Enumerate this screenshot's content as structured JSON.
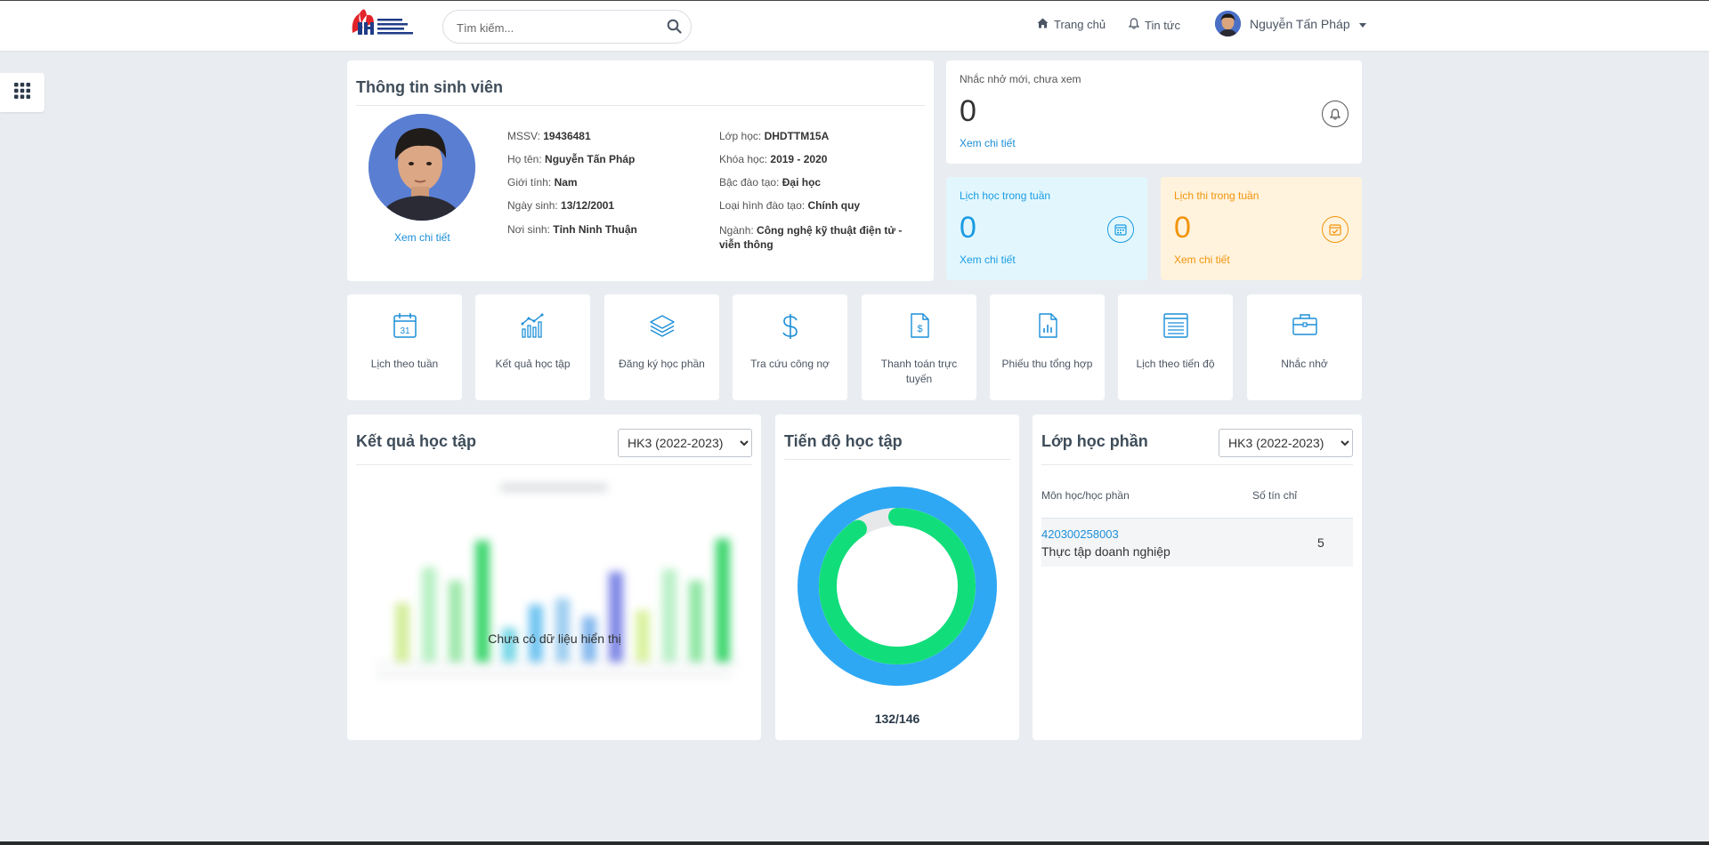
{
  "header": {
    "search_placeholder": "Tìm kiếm...",
    "nav_home": "Trang chủ",
    "nav_news": "Tin tức",
    "user_name": "Nguyễn Tấn Pháp"
  },
  "student": {
    "title": "Thông tin sinh viên",
    "view_detail": "Xem chi tiết",
    "fields": [
      {
        "label": "MSSV:",
        "value": "19436481"
      },
      {
        "label": "Họ tên:",
        "value": "Nguyễn Tấn Pháp"
      },
      {
        "label": "Giới tính:",
        "value": "Nam"
      },
      {
        "label": "Ngày sinh:",
        "value": "13/12/2001"
      },
      {
        "label": "Nơi sinh:",
        "value": "Tỉnh Ninh Thuận"
      },
      {
        "label": "Lớp học:",
        "value": "DHDTTM15A"
      },
      {
        "label": "Khóa học:",
        "value": "2019 - 2020"
      },
      {
        "label": "Bậc đào tạo:",
        "value": "Đại học"
      },
      {
        "label": "Loại hình đào tạo:",
        "value": "Chính quy"
      },
      {
        "label": "Ngành:",
        "value": "Công nghệ kỹ thuật điện tử - viễn thông"
      }
    ]
  },
  "stats": {
    "reminders": {
      "label": "Nhắc nhở mới, chưa xem",
      "count": "0",
      "link": "Xem chi tiết"
    },
    "week_schedule": {
      "label": "Lịch học trong tuần",
      "count": "0",
      "link": "Xem chi tiết"
    },
    "exam_schedule": {
      "label": "Lịch thi trong tuần",
      "count": "0",
      "link": "Xem chi tiết"
    }
  },
  "quick_links": [
    {
      "label": "Lịch theo tuần",
      "icon": "calendar-31-icon"
    },
    {
      "label": "Kết quả học tập",
      "icon": "bar-chart-trend-icon"
    },
    {
      "label": "Đăng ký học phần",
      "icon": "layers-icon"
    },
    {
      "label": "Tra cứu công nợ",
      "icon": "dollar-icon"
    },
    {
      "label": "Thanh toán trực tuyến",
      "icon": "invoice-dollar-icon"
    },
    {
      "label": "Phiếu thu tổng hợp",
      "icon": "document-chart-icon"
    },
    {
      "label": "Lịch theo tiến độ",
      "icon": "list-document-icon"
    },
    {
      "label": "Nhắc nhở",
      "icon": "briefcase-icon"
    }
  ],
  "results": {
    "title": "Kết quả học tập",
    "semester": "HK3 (2022-2023)",
    "no_data": "Chưa có dữ liệu hiển thị"
  },
  "progress": {
    "title": "Tiến độ học tập",
    "completed": 132,
    "total": 146,
    "text": "132/146"
  },
  "classes": {
    "title": "Lớp học phần",
    "semester": "HK3 (2022-2023)",
    "col_course": "Môn học/học phần",
    "col_credits": "Số tín chỉ",
    "rows": [
      {
        "code": "420300258003",
        "name": "Thực tập doanh nghiệp",
        "credits": "5"
      }
    ]
  },
  "colors": {
    "accent_blue": "#1b8ed8",
    "week_bg": "#e2f7fd",
    "exam_bg": "#fff3dd",
    "exam_orange": "#f1940b",
    "donut_outer": "#2fa8f4",
    "donut_inner": "#11de7a"
  }
}
